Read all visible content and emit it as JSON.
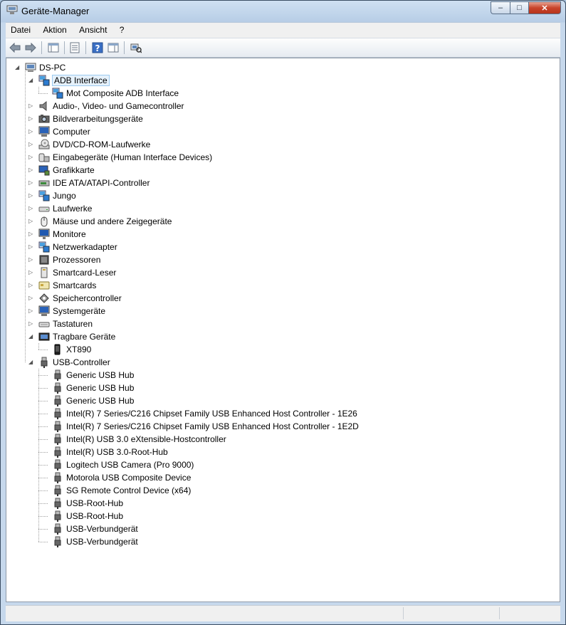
{
  "window": {
    "title": "Geräte-Manager"
  },
  "menu": [
    "Datei",
    "Aktion",
    "Ansicht",
    "?"
  ],
  "tree": {
    "root": "DS-PC",
    "categories": [
      {
        "label": "ADB Interface",
        "icon": "adb-icon",
        "expanded": true,
        "selected": true,
        "children": [
          "Mot Composite ADB Interface"
        ]
      },
      {
        "label": "Audio-, Video- und Gamecontroller",
        "icon": "speaker-icon"
      },
      {
        "label": "Bildverarbeitungsgeräte",
        "icon": "camera-icon"
      },
      {
        "label": "Computer",
        "icon": "computer-icon"
      },
      {
        "label": "DVD/CD-ROM-Laufwerke",
        "icon": "disc-drive-icon"
      },
      {
        "label": "Eingabegeräte (Human Interface Devices)",
        "icon": "hid-icon"
      },
      {
        "label": "Grafikkarte",
        "icon": "display-adapter-icon"
      },
      {
        "label": "IDE ATA/ATAPI-Controller",
        "icon": "ide-controller-icon"
      },
      {
        "label": "Jungo",
        "icon": "jungo-icon"
      },
      {
        "label": "Laufwerke",
        "icon": "disk-drive-icon"
      },
      {
        "label": "Mäuse und andere Zeigegeräte",
        "icon": "mouse-icon"
      },
      {
        "label": "Monitore",
        "icon": "monitor-icon"
      },
      {
        "label": "Netzwerkadapter",
        "icon": "network-adapter-icon"
      },
      {
        "label": "Prozessoren",
        "icon": "processor-icon"
      },
      {
        "label": "Smartcard-Leser",
        "icon": "smartcard-reader-icon"
      },
      {
        "label": "Smartcards",
        "icon": "smartcard-icon"
      },
      {
        "label": "Speichercontroller",
        "icon": "storage-controller-icon"
      },
      {
        "label": "Systemgeräte",
        "icon": "system-device-icon"
      },
      {
        "label": "Tastaturen",
        "icon": "keyboard-icon"
      },
      {
        "label": "Tragbare Geräte",
        "icon": "portable-device-icon",
        "expanded": true,
        "children": [
          "XT890"
        ]
      },
      {
        "label": "USB-Controller",
        "icon": "usb-icon",
        "expanded": true,
        "children": [
          "Generic USB Hub",
          "Generic USB Hub",
          "Generic USB Hub",
          "Intel(R) 7 Series/C216 Chipset Family USB Enhanced Host Controller - 1E26",
          "Intel(R) 7 Series/C216 Chipset Family USB Enhanced Host Controller - 1E2D",
          "Intel(R) USB 3.0 eXtensible-Hostcontroller",
          "Intel(R) USB 3.0-Root-Hub",
          "Logitech USB Camera (Pro 9000)",
          "Motorola USB Composite Device",
          "SG Remote Control Device (x64)",
          "USB-Root-Hub",
          "USB-Root-Hub",
          "USB-Verbundgerät",
          "USB-Verbundgerät"
        ]
      }
    ]
  }
}
